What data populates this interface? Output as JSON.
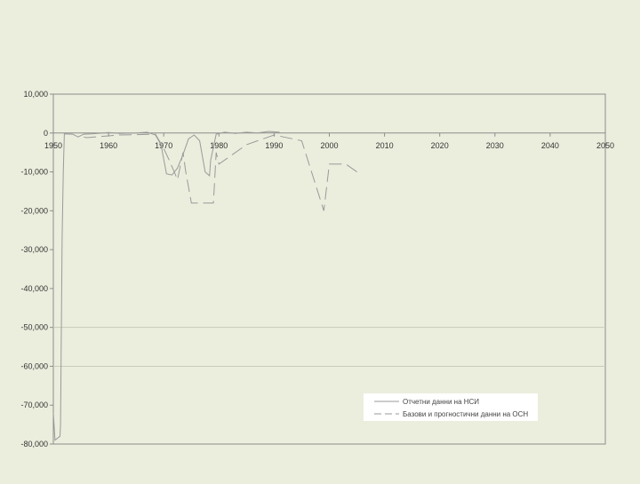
{
  "colors": {
    "background": "#ebeedd",
    "plot_background": "#ebeedd",
    "axis": "#8c8c8c",
    "gridline": "#c8cbb8",
    "series_line": "#9a9a9a",
    "legend_background": "#ffffff"
  },
  "chart_data": {
    "type": "line",
    "title": "",
    "xlabel": "",
    "ylabel": "",
    "xlim": [
      1950,
      2050
    ],
    "ylim": [
      -80000,
      10000
    ],
    "x_ticks": [
      "1950",
      "1960",
      "1970",
      "1980",
      "1990",
      "2000",
      "2010",
      "2020",
      "2030",
      "2040",
      "2050"
    ],
    "y_ticks": [
      "10,000",
      "0",
      "-10,000",
      "-20,000",
      "-30,000",
      "-40,000",
      "-50,000",
      "-60,000",
      "-70,000",
      "-80,000"
    ],
    "grid": "horizontal lines at -50,000 and -60,000",
    "legend_position": "bottom-right",
    "series": [
      {
        "name": "Отчетни данни на НСИ",
        "style": "solid",
        "points": [
          [
            1950.0,
            -72000
          ],
          [
            1950.3,
            -79000
          ],
          [
            1951.2,
            -78000
          ],
          [
            1951.3,
            -75000
          ],
          [
            1951.6,
            -27000
          ],
          [
            1951.8,
            -10000
          ],
          [
            1952.0,
            -200
          ],
          [
            1953.5,
            -300
          ],
          [
            1954.5,
            -1000
          ],
          [
            1955.5,
            -300
          ],
          [
            1957.0,
            -200
          ],
          [
            1960.0,
            100
          ],
          [
            1962.0,
            -100
          ],
          [
            1965.0,
            0
          ],
          [
            1967.0,
            200
          ],
          [
            1968.5,
            -500
          ],
          [
            1969.5,
            -3000
          ],
          [
            1970.5,
            -10500
          ],
          [
            1971.5,
            -10800
          ],
          [
            1972.5,
            -9000
          ],
          [
            1973.5,
            -5500
          ],
          [
            1974.5,
            -1500
          ],
          [
            1975.5,
            -500
          ],
          [
            1976.5,
            -2000
          ],
          [
            1977.5,
            -10000
          ],
          [
            1978.3,
            -11000
          ],
          [
            1978.5,
            -7000
          ],
          [
            1979.5,
            -300
          ],
          [
            1981.0,
            200
          ],
          [
            1983.0,
            -100
          ],
          [
            1985.0,
            200
          ],
          [
            1987.0,
            0
          ],
          [
            1989.0,
            400
          ],
          [
            1991.0,
            200
          ]
        ]
      },
      {
        "name": "Базови и прогностични данни на ОСН",
        "style": "dashed",
        "points": [
          [
            1955.5,
            -1000
          ],
          [
            1956.0,
            -1200
          ],
          [
            1962.0,
            -500
          ],
          [
            1968.5,
            -300
          ],
          [
            1970.0,
            -4000
          ],
          [
            1971.0,
            -7000
          ],
          [
            1972.5,
            -12000
          ],
          [
            1973.5,
            -5000
          ],
          [
            1974.0,
            -10000
          ],
          [
            1975.0,
            -18000
          ],
          [
            1976.0,
            -18000
          ],
          [
            1977.0,
            -18000
          ],
          [
            1978.0,
            -18000
          ],
          [
            1979.0,
            -18000
          ],
          [
            1979.5,
            -5000
          ],
          [
            1980.0,
            -8000
          ],
          [
            1985.0,
            -3000
          ],
          [
            1990.0,
            -500
          ],
          [
            1995.0,
            -2000
          ],
          [
            1999.0,
            -20000
          ],
          [
            2000.0,
            -8000
          ],
          [
            2003.0,
            -8000
          ],
          [
            2005.0,
            -10000
          ]
        ]
      }
    ]
  }
}
